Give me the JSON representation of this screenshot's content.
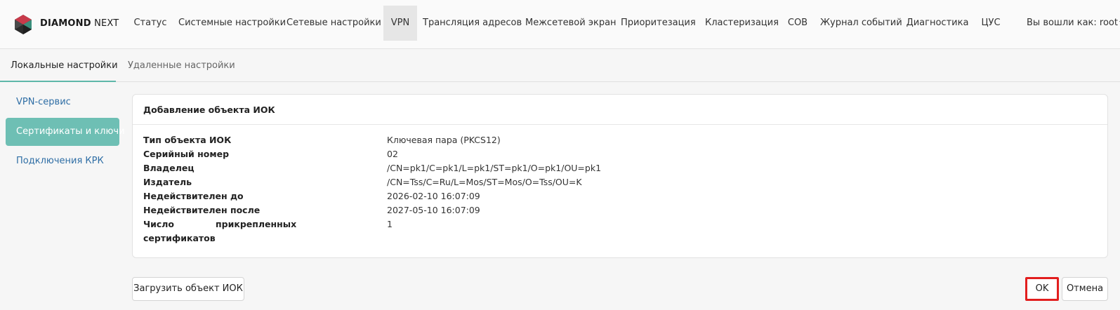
{
  "app": {
    "brand_bold": "DIAMOND",
    "brand_light": "NEXT"
  },
  "nav": {
    "items": [
      {
        "label": "Статус"
      },
      {
        "label": "Системные настройки"
      },
      {
        "label": "Сетевые настройки"
      },
      {
        "label": "VPN"
      },
      {
        "label": "Трансляция адресов"
      },
      {
        "label": "Межсетевой экран"
      },
      {
        "label": "Приоритезация"
      },
      {
        "label": "Кластеризация"
      },
      {
        "label": "СОВ"
      },
      {
        "label": "Журнал событий"
      },
      {
        "label": "Диагностика"
      },
      {
        "label": "ЦУС"
      }
    ],
    "active": "VPN",
    "user_label": "Вы вошли как: root"
  },
  "subtabs": [
    {
      "label": "Локальные настройки"
    },
    {
      "label": "Удаленные настройки"
    }
  ],
  "sidebar": {
    "items": [
      {
        "label": "VPN-сервис"
      },
      {
        "label": "Сертификаты и ключи"
      },
      {
        "label": "Подключения КРК"
      }
    ],
    "active": "Сертификаты и ключи"
  },
  "card": {
    "title": "Добавление объекта ИОК",
    "rows": [
      {
        "label": "Тип объекта ИОК",
        "value": "Ключевая пара (PKCS12)"
      },
      {
        "label": "Серийный номер",
        "value": "02"
      },
      {
        "label": "Владелец",
        "value": "/CN=pk1/C=pk1/L=pk1/ST=pk1/O=pk1/OU=pk1"
      },
      {
        "label": "Издатель",
        "value": "/CN=Tss/C=Ru/L=Mos/ST=Mos/O=Tss/OU=K"
      },
      {
        "label": "Недействителен до",
        "value": "2026-02-10 16:07:09"
      },
      {
        "label": "Недействителен после",
        "value": "2027-05-10 16:07:09"
      },
      {
        "label": "Число прикрепленных сертификатов",
        "label_line1_a": "Число",
        "label_line1_b": "прикрепленных",
        "label_line2": "сертификатов",
        "value": "1"
      }
    ]
  },
  "buttons": {
    "upload": "Загрузить объект ИОК",
    "ok": "OK",
    "cancel": "Отмена"
  },
  "colors": {
    "accent": "#6ebfb4",
    "link": "#2f6ea5",
    "highlight": "#e21e1e"
  }
}
